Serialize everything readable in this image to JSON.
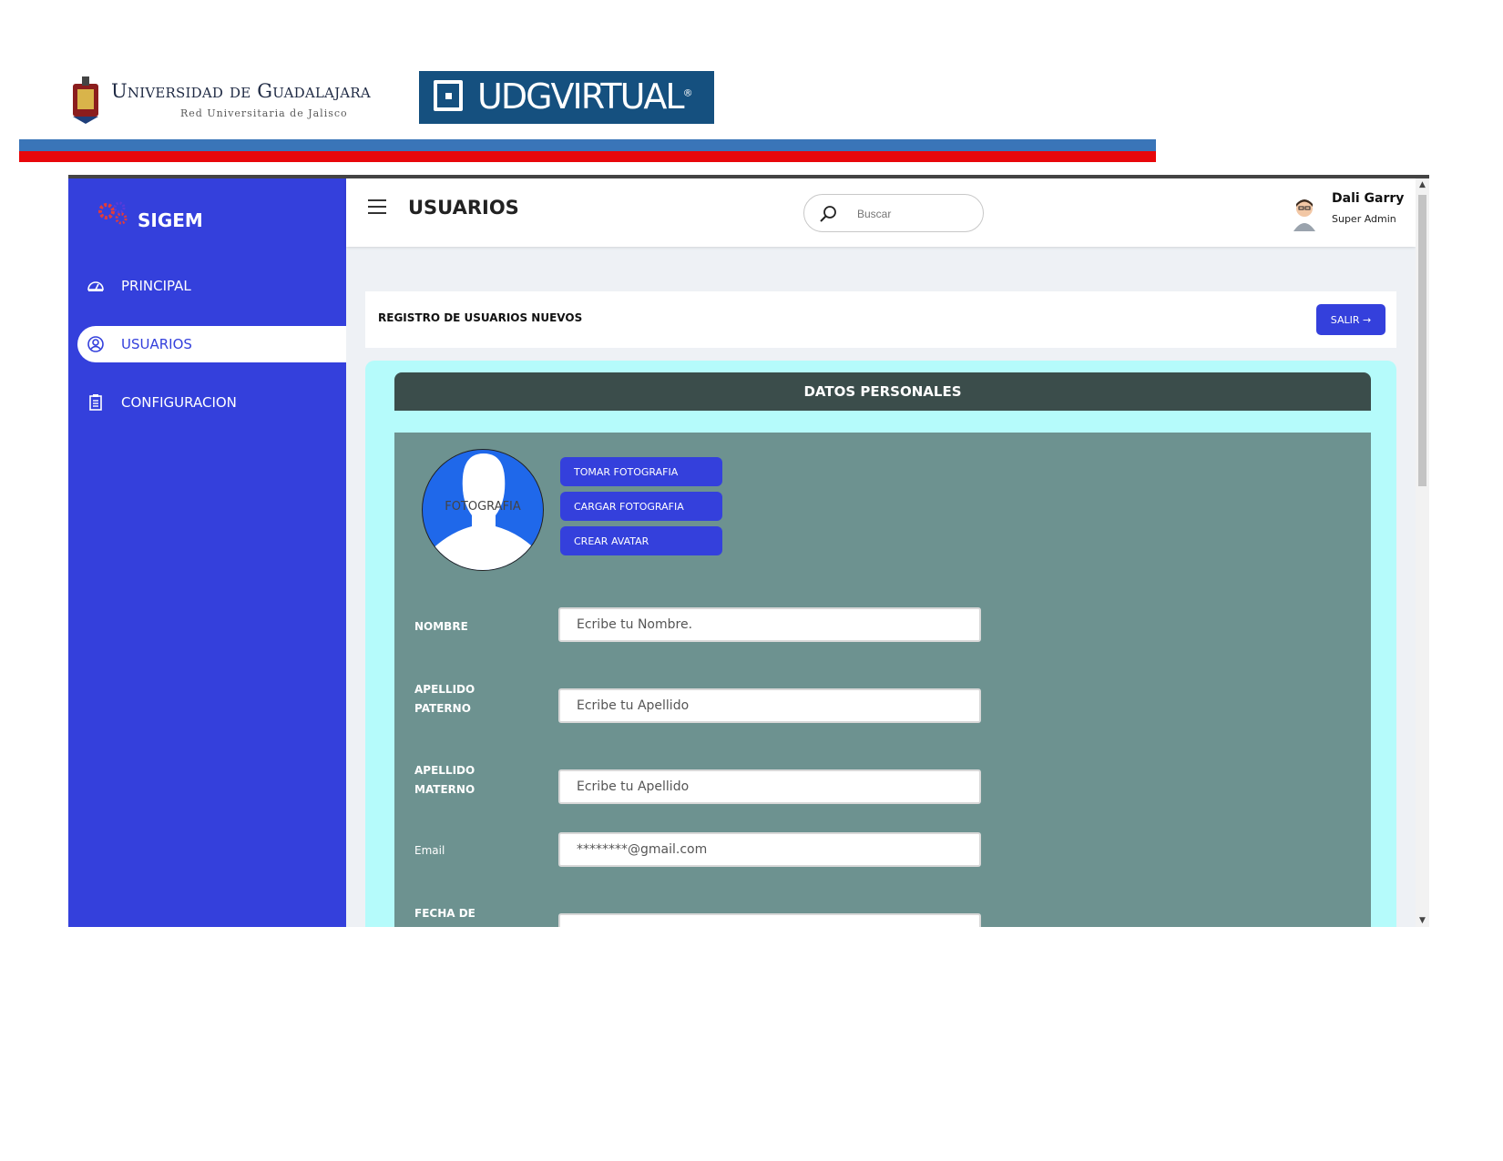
{
  "document_header": {
    "university_name": "Universidad de Guadalajara",
    "university_subtitle": "Red Universitaria de Jalisco",
    "virtual_brand": "UDGVIRTUAL",
    "virtual_brand_mark": "®",
    "colors": {
      "stripe_top": "#3a75b8",
      "stripe_bottom": "#e8070b",
      "virtual_bg": "#15507f"
    }
  },
  "app": {
    "brand": "SIGEM",
    "colors": {
      "sidebar": "#3440dc",
      "accent": "#3440dc",
      "form_bg": "#b5fbfb",
      "form_body": "#6d9290",
      "section_header": "#3b4d4b"
    },
    "sidebar": {
      "items": [
        {
          "label": "PRINCIPAL",
          "icon": "dashboard-icon",
          "active": false
        },
        {
          "label": "USUARIOS",
          "icon": "user-circle-icon",
          "active": true
        },
        {
          "label": "CONFIGURACION",
          "icon": "clipboard-icon",
          "active": false
        }
      ]
    },
    "topbar": {
      "title": "USUARIOS",
      "search_placeholder": "Buscar",
      "user_name": "Dali Garry",
      "user_role": "Super Admin"
    },
    "card": {
      "title": "REGISTRO DE USUARIOS NUEVOS",
      "exit_button": "SALIR →"
    },
    "form": {
      "section_title": "DATOS PERSONALES",
      "photo_label": "FOTOGRAFIA",
      "photo_buttons": [
        "TOMAR FOTOGRAFIA",
        "CARGAR FOTOGRAFIA",
        "CREAR AVATAR"
      ],
      "fields": [
        {
          "label": "NOMBRE",
          "placeholder": "Ecribe tu Nombre."
        },
        {
          "label": "APELLIDO PATERNO",
          "placeholder": "Ecribe tu Apellido"
        },
        {
          "label": "APELLIDO MATERNO",
          "placeholder": "Ecribe tu Apellido"
        },
        {
          "label": "Email",
          "placeholder": "********@gmail.com"
        },
        {
          "label": "FECHA DE",
          "placeholder": ""
        }
      ]
    }
  }
}
